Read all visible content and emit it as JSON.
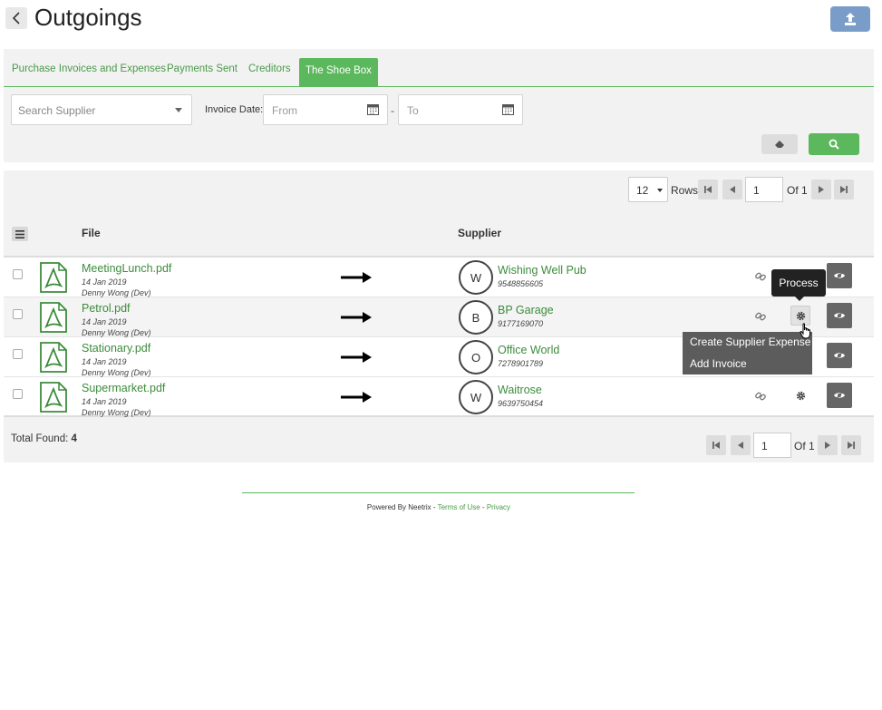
{
  "header": {
    "title": "Outgoings"
  },
  "tabs": [
    {
      "label": "Purchase Invoices and Expenses",
      "active": false
    },
    {
      "label": "Payments Sent",
      "active": false
    },
    {
      "label": "Creditors",
      "active": false
    },
    {
      "label": "The Shoe Box",
      "active": true
    }
  ],
  "filters": {
    "supplier_placeholder": "Search Supplier",
    "invoice_date_label": "Invoice Date:",
    "from_placeholder": "From",
    "to_placeholder": "To",
    "separator": "-"
  },
  "pagination": {
    "rows_value": "12",
    "rows_label": "Rows",
    "page": "1",
    "of_label": "Of 1"
  },
  "table": {
    "columns": {
      "file": "File",
      "supplier": "Supplier"
    },
    "rows": [
      {
        "file": "MeetingLunch.pdf",
        "date": "14 Jan 2019",
        "user": "Denny Wong (Dev)",
        "initial": "W",
        "supplier": "Wishing Well Pub",
        "phone": "9548856605"
      },
      {
        "file": "Petrol.pdf",
        "date": "14 Jan 2019",
        "user": "Denny Wong (Dev)",
        "initial": "B",
        "supplier": "BP Garage",
        "phone": "9177169070"
      },
      {
        "file": "Stationary.pdf",
        "date": "14 Jan 2019",
        "user": "Denny Wong (Dev)",
        "initial": "O",
        "supplier": "Office World",
        "phone": "7278901789"
      },
      {
        "file": "Supermarket.pdf",
        "date": "14 Jan 2019",
        "user": "Denny Wong (Dev)",
        "initial": "W",
        "supplier": "Waitrose",
        "phone": "9639750454"
      }
    ]
  },
  "tooltip": {
    "label": "Process"
  },
  "context_menu": {
    "items": [
      "Create Supplier Expense",
      "Add Invoice"
    ]
  },
  "summary": {
    "total_label": "Total Found:",
    "total_value": "4"
  },
  "footer": {
    "powered_by": "Powered By Neetrix - ",
    "terms": "Terms of Use",
    "sep": " - ",
    "privacy": "Privacy"
  },
  "colors": {
    "accent": "#5cb85c",
    "link": "#3c8c3c",
    "upload": "#7a9cc8"
  },
  "icons": {
    "back": "chevron-left-icon",
    "upload": "upload-icon",
    "calendar": "calendar-icon",
    "clear": "eraser-icon",
    "search": "search-icon",
    "file": "pdf-file-icon",
    "link": "unlink-icon",
    "gear": "gear-icon",
    "view": "eye-icon"
  }
}
